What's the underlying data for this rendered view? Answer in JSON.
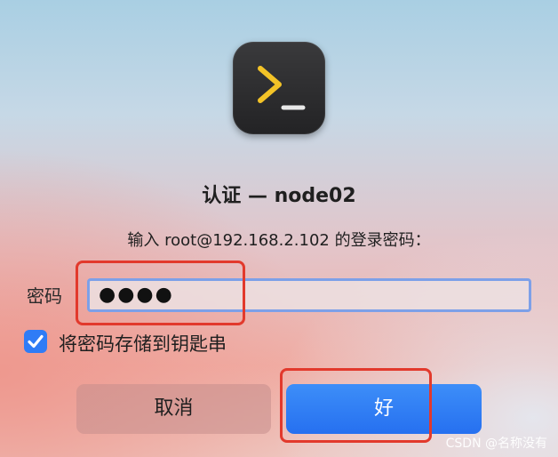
{
  "app_icon": "terminal-icon",
  "dialog": {
    "title": "认证 — node02",
    "prompt": "输入 root@192.168.2.102 的登录密码："
  },
  "password": {
    "label": "密码",
    "value": "●●●●"
  },
  "keychain": {
    "checked": true,
    "label": "将密码存储到钥匙串"
  },
  "buttons": {
    "cancel_label": "取消",
    "ok_label": "好"
  },
  "watermark": "CSDN @名称没有",
  "colors": {
    "accent": "#2f7cf6",
    "annotation": "#e2392c"
  }
}
